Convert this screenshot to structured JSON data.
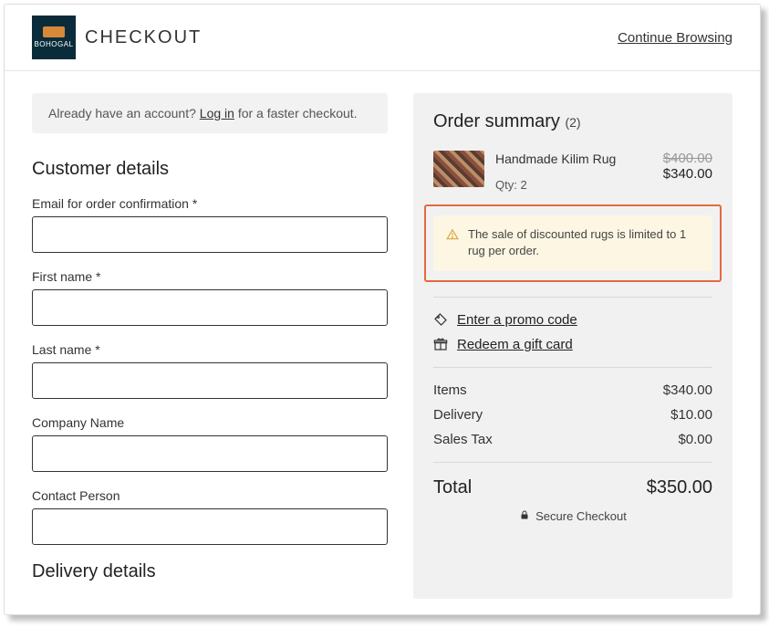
{
  "header": {
    "brand_text": "BOHOGAL",
    "page_title": "CHECKOUT",
    "continue_link": "Continue Browsing"
  },
  "account_bar": {
    "prefix": "Already have an account? ",
    "login": "Log in",
    "suffix": " for a faster checkout."
  },
  "customer_details": {
    "heading": "Customer details",
    "fields": {
      "email_label": "Email for order confirmation *",
      "first_name_label": "First name *",
      "last_name_label": "Last name *",
      "company_label": "Company Name",
      "contact_person_label": "Contact Person"
    },
    "values": {
      "email": "",
      "first_name": "",
      "last_name": "",
      "company": "",
      "contact_person": ""
    }
  },
  "delivery_heading": "Delivery details",
  "order_summary": {
    "title": "Order summary",
    "count": "(2)",
    "item": {
      "name": "Handmade Kilim Rug",
      "qty_label": "Qty: 2",
      "original_price": "$400.00",
      "price": "$340.00"
    },
    "warning": "The sale of discounted rugs is limited to 1 rug per order.",
    "promo_link": "Enter a promo code",
    "gift_link": "Redeem a gift card",
    "lines": {
      "items_label": "Items",
      "items_value": "$340.00",
      "delivery_label": "Delivery",
      "delivery_value": "$10.00",
      "tax_label": "Sales Tax",
      "tax_value": "$0.00",
      "total_label": "Total",
      "total_value": "$350.00"
    },
    "secure_text": "Secure Checkout"
  }
}
